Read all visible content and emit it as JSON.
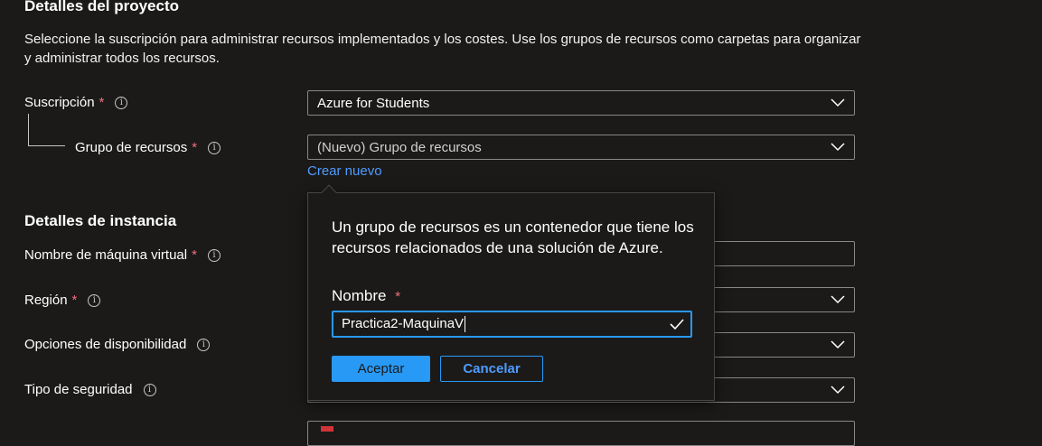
{
  "project_details": {
    "title": "Detalles del proyecto",
    "description": "Seleccione la suscripción para administrar recursos implementados y los costes. Use los grupos de recursos como carpetas para organizar y administrar todos los recursos.",
    "subscription": {
      "label": "Suscripción",
      "required": "*",
      "value": "Azure for Students"
    },
    "resource_group": {
      "label": "Grupo de recursos",
      "required": "*",
      "value": "(Nuevo) Grupo de recursos",
      "create_new": "Crear nuevo"
    }
  },
  "instance_details": {
    "title": "Detalles de instancia",
    "vm_name": {
      "label": "Nombre de máquina virtual",
      "required": "*"
    },
    "region": {
      "label": "Región",
      "required": "*"
    },
    "availability": {
      "label": "Opciones de disponibilidad"
    },
    "security": {
      "label": "Tipo de seguridad"
    }
  },
  "popup": {
    "description": "Un grupo de recursos es un contenedor que tiene los recursos relacionados de una solución de Azure.",
    "name_label": "Nombre",
    "required": "*",
    "name_value": "Practica2-MaquinaV",
    "accept_label": "Aceptar",
    "cancel_label": "Cancelar"
  },
  "icons": {
    "info": "i"
  },
  "colors": {
    "background": "#1b1a19",
    "accent": "#2899f5",
    "link": "#4f9bff",
    "required": "#f1707b"
  }
}
